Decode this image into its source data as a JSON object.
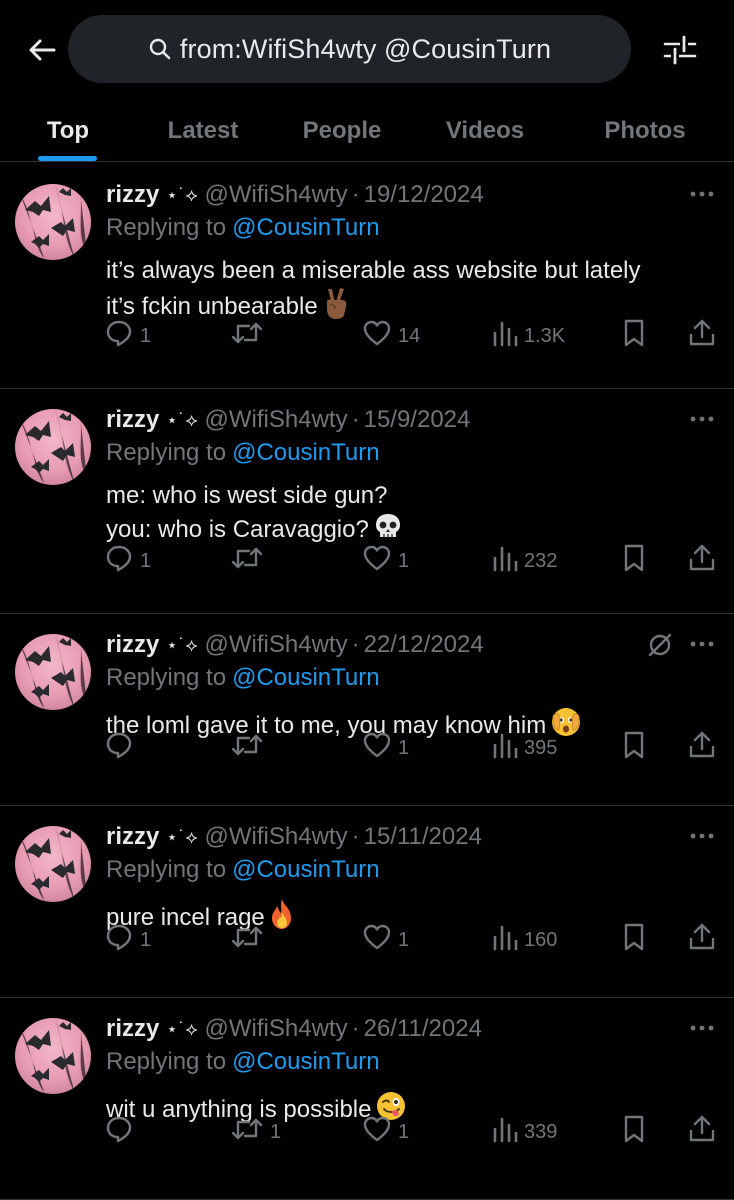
{
  "header": {
    "search_query": "from:WifiSh4wty @CousinTurn",
    "icons": {
      "back": "arrow-left-icon",
      "search": "search-icon",
      "filter": "sliders-icon"
    }
  },
  "tabs": [
    {
      "label": "Top",
      "active": true
    },
    {
      "label": "Latest",
      "active": false
    },
    {
      "label": "People",
      "active": false
    },
    {
      "label": "Videos",
      "active": false
    },
    {
      "label": "Photos",
      "active": false
    }
  ],
  "colors": {
    "background": "#000000",
    "accent": "#1d9bf0",
    "muted": "#71767b",
    "text": "#e7e9ea",
    "divider": "#2f3336"
  },
  "tweets": [
    {
      "display_name": "rizzy",
      "name_decoration": "⋆˙⟡",
      "handle": "@WifiSh4wty",
      "separator": "·",
      "date": "19/12/2024",
      "reply_prefix": "Replying to",
      "reply_to": "@CousinTurn",
      "text": "it’s always been a miserable ass website but lately\nit’s fckin unbearable",
      "emoji": "victory-hand",
      "replies": "1",
      "retweets": "",
      "likes": "14",
      "views": "1.3K"
    },
    {
      "display_name": "rizzy",
      "name_decoration": "⋆˙⟡",
      "handle": "@WifiSh4wty",
      "separator": "·",
      "date": "15/9/2024",
      "reply_prefix": "Replying to",
      "reply_to": "@CousinTurn",
      "text": "me: who is west side gun?\nyou: who is Caravaggio?",
      "emoji": "skull",
      "replies": "1",
      "retweets": "",
      "likes": "1",
      "views": "232"
    },
    {
      "display_name": "rizzy",
      "name_decoration": "⋆˙⟡",
      "handle": "@WifiSh4wty",
      "separator": "·",
      "date": "22/12/2024",
      "reply_prefix": "Replying to",
      "reply_to": "@CousinTurn",
      "text": "the loml gave it to me, you may know him",
      "emoji": "face-peeking",
      "replies": "",
      "retweets": "",
      "likes": "1",
      "views": "395",
      "reply_restricted": true
    },
    {
      "display_name": "rizzy",
      "name_decoration": "⋆˙⟡",
      "handle": "@WifiSh4wty",
      "separator": "·",
      "date": "15/11/2024",
      "reply_prefix": "Replying to",
      "reply_to": "@CousinTurn",
      "text": "pure incel rage",
      "emoji": "fire",
      "replies": "1",
      "retweets": "",
      "likes": "1",
      "views": "160"
    },
    {
      "display_name": "rizzy",
      "name_decoration": "⋆˙⟡",
      "handle": "@WifiSh4wty",
      "separator": "·",
      "date": "26/11/2024",
      "reply_prefix": "Replying to",
      "reply_to": "@CousinTurn",
      "text": "wit u anything is possible",
      "emoji": "winking-tongue",
      "replies": "",
      "retweets": "1",
      "likes": "1",
      "views": "339"
    }
  ]
}
